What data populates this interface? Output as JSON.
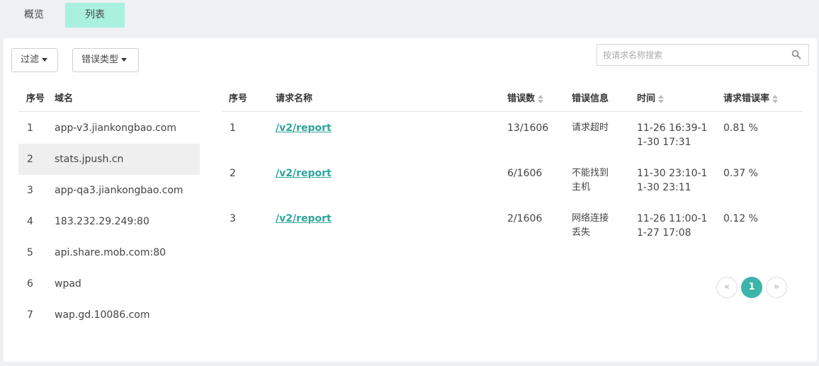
{
  "tabs": {
    "overview": "概览",
    "list": "列表"
  },
  "toolbar": {
    "filter_label": "过滤",
    "error_type_label": "错误类型",
    "search_placeholder": "按请求名称搜索"
  },
  "domains": {
    "headers": {
      "index": "序号",
      "domain": "域名"
    },
    "rows": [
      {
        "index": "1",
        "domain": "app-v3.jiankongbao.com"
      },
      {
        "index": "2",
        "domain": "stats.jpush.cn"
      },
      {
        "index": "3",
        "domain": "app-qa3.jiankongbao.com"
      },
      {
        "index": "4",
        "domain": "183.232.29.249:80"
      },
      {
        "index": "5",
        "domain": "api.share.mob.com:80"
      },
      {
        "index": "6",
        "domain": "wpad"
      },
      {
        "index": "7",
        "domain": "wap.gd.10086.com"
      }
    ],
    "selected_index": "2"
  },
  "requests": {
    "headers": {
      "index": "序号",
      "name": "请求名称",
      "errors": "错误数",
      "info": "错误信息",
      "time": "时间",
      "rate": "请求错误率"
    },
    "rows": [
      {
        "index": "1",
        "name": "/v2/report",
        "errors": "13/1606",
        "info": "请求超时",
        "time": "11-26 16:39-11-30 17:31",
        "rate": "0.81 %"
      },
      {
        "index": "2",
        "name": "/v2/report",
        "errors": "6/1606",
        "info": "不能找到主机",
        "time": "11-30 23:10-11-30 23:11",
        "rate": "0.37 %"
      },
      {
        "index": "3",
        "name": "/v2/report",
        "errors": "2/1606",
        "info": "网络连接丢失",
        "time": "11-26 11:00-11-27 17:08",
        "rate": "0.12 %"
      }
    ]
  },
  "pagination": {
    "prev": "«",
    "current": "1",
    "next": "»"
  },
  "colors": {
    "accent": "#3cb4a9",
    "tab_active": "#aaf0df",
    "link": "#2fa59a"
  }
}
